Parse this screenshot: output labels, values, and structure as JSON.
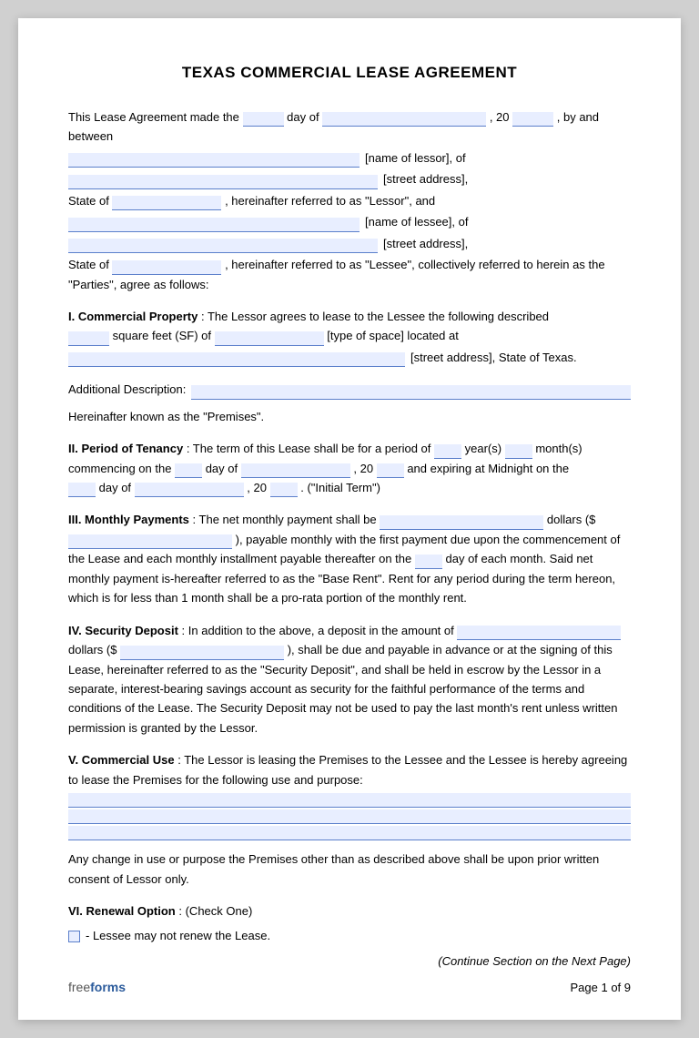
{
  "document": {
    "title": "TEXAS COMMERCIAL LEASE AGREEMENT",
    "footer": {
      "brand_free": "free",
      "brand_forms": "forms",
      "page_label": "Page 1 of 9"
    },
    "sections": {
      "intro": {
        "text1": "This Lease Agreement made the",
        "text2": "day of",
        "text3": ", 20",
        "text4": ", by and between",
        "text5": "[name of lessor], of",
        "text6": "[street address],",
        "text7": "State of",
        "text8": ", hereinafter referred to as \"Lessor\", and",
        "text9": "[name of lessee], of",
        "text10": "[street address],",
        "text11": "State of",
        "text12": ", hereinafter referred to as \"Lessee\", collectively referred to herein as the \"Parties\", agree as follows:"
      },
      "section1": {
        "title": "I. Commercial Property",
        "text": ": The Lessor agrees to lease to the Lessee the following described",
        "text2": "square feet (SF) of",
        "text3": "[type of space] located at",
        "text4": "[street address], State of Texas."
      },
      "additional": {
        "label": "Additional Description:",
        "note": "Hereinafter known as the \"Premises\"."
      },
      "section2": {
        "title": "II. Period of Tenancy",
        "text": ": The term of this Lease shall be for a period of",
        "text2": "year(s)",
        "text3": "month(s) commencing on the",
        "text4": "day of",
        "text5": ", 20",
        "text6": "and expiring at Midnight on the",
        "text7": "day of",
        "text8": ", 20",
        "text9": ". (\"Initial Term\")"
      },
      "section3": {
        "title": "III. Monthly Payments",
        "text": ": The net monthly payment shall be",
        "text2": "dollars ($",
        "text3": "), payable monthly with the first payment due upon the commencement of the Lease and each monthly installment payable thereafter on the",
        "text4": "day of each month. Said net monthly payment is-hereafter referred to as the \"Base Rent\". Rent for any period during the term hereon, which is for less than 1 month shall be a pro-rata portion of the monthly rent."
      },
      "section4": {
        "title": "IV. Security Deposit",
        "text": ": In addition to the above, a deposit in the amount of",
        "text2": "dollars ($",
        "text3": "), shall be due and payable in advance or at the signing of this Lease, hereinafter referred to as the \"Security Deposit\", and shall be held in escrow by the Lessor in a separate, interest-bearing savings account as security for the faithful performance of the terms and conditions of the Lease. The Security Deposit may not be used to pay the last month's rent unless written permission is granted by the Lessor."
      },
      "section5": {
        "title": "V. Commercial Use",
        "text": ": The Lessor is leasing the Premises to the Lessee and the Lessee is hereby agreeing to lease the Premises for the following use and purpose:",
        "text2": "Any change in use or purpose the Premises other than as described above shall be upon prior written consent of Lessor only."
      },
      "section6": {
        "title": "VI. Renewal Option",
        "text": ": (Check One)",
        "checkbox1": "- Lessee may not renew the Lease.",
        "continue": "(Continue Section on the Next Page)"
      }
    }
  }
}
